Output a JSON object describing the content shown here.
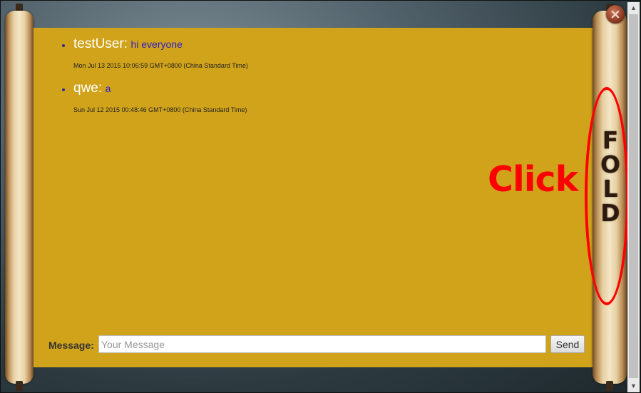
{
  "chat": {
    "messages": [
      {
        "user": "testUser:",
        "text": "hi everyone",
        "time": "Mon Jul 13 2015 10:06:59 GMT+0800 (China Standard Time)"
      },
      {
        "user": "qwe:",
        "text": "a",
        "time": "Sun Jul 12 2015 00:48:46 GMT+0800 (China Standard Time)"
      }
    ]
  },
  "form": {
    "message_label": "Message:",
    "placeholder": "Your Message",
    "value": "",
    "send_label": "Send"
  },
  "annotation": {
    "click_label": "Click",
    "fold_letters": [
      "F",
      "O",
      "L",
      "D"
    ]
  },
  "close": {
    "glyph": "×"
  },
  "colors": {
    "panel": "#d1a31a",
    "username": "#ffffff",
    "message_text": "#2c1ec9",
    "annotation": "#ff0000"
  },
  "icons": {
    "close": "close-icon",
    "scroll_up": "arrow-up-icon",
    "scroll_down": "arrow-down-icon"
  }
}
